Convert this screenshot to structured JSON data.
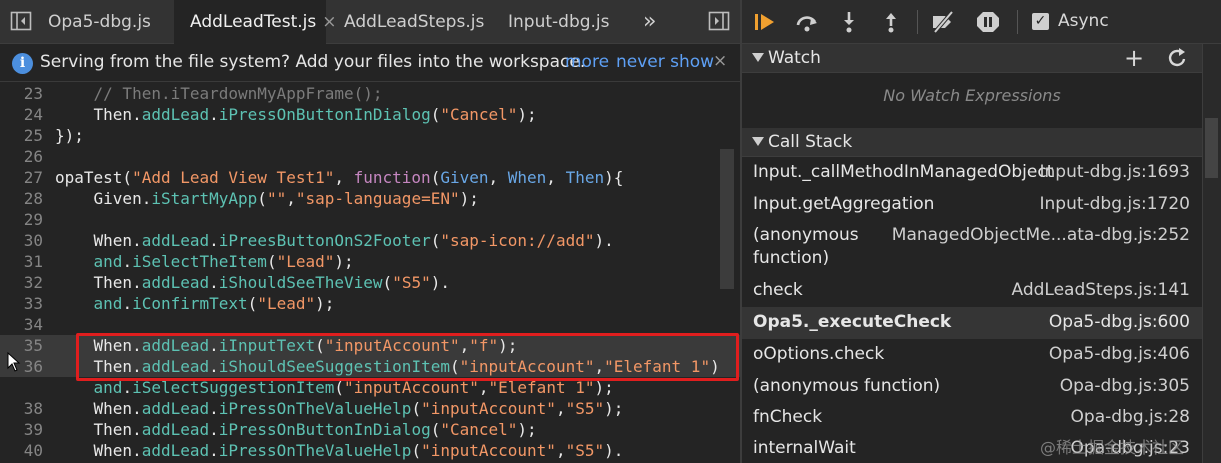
{
  "editor_tabs": [
    {
      "label": "Opa5-dbg.js",
      "active": false,
      "closable": false
    },
    {
      "label": "AddLeadTest.js",
      "active": true,
      "closable": true
    },
    {
      "label": "AddLeadSteps.js",
      "active": false,
      "closable": false
    },
    {
      "label": "Input-dbg.js",
      "active": false,
      "closable": false
    }
  ],
  "overflow_tabs_label": "»",
  "tab_close_glyph": "×",
  "infobar": {
    "icon": "info-icon",
    "message": "Serving from the file system? Add your files into the workspace.",
    "more_label": "more",
    "never_show_label": "never show",
    "close_glyph": "×"
  },
  "code_lines": [
    {
      "num": "23",
      "tokens": [
        [
          "    ",
          "plain"
        ],
        [
          "// Then.iTeardownMyAppFrame();",
          "com"
        ]
      ]
    },
    {
      "num": "24",
      "tokens": [
        [
          "    Then.",
          "plain"
        ],
        [
          "addLead",
          "prop"
        ],
        [
          ".",
          "plain"
        ],
        [
          "iPressOnButtonInDialog",
          "prop"
        ],
        [
          "(",
          "plain"
        ],
        [
          "\"Cancel\"",
          "str"
        ],
        [
          ");",
          "plain"
        ]
      ]
    },
    {
      "num": "25",
      "tokens": [
        [
          "});",
          "plain"
        ]
      ]
    },
    {
      "num": "26",
      "tokens": []
    },
    {
      "num": "27",
      "tokens": [
        [
          "opaTest(",
          "plain"
        ],
        [
          "\"Add Lead View Test1\"",
          "str"
        ],
        [
          ", ",
          "plain"
        ],
        [
          "function",
          "kw"
        ],
        [
          "(",
          "plain"
        ],
        [
          "Given",
          "param"
        ],
        [
          ", ",
          "plain"
        ],
        [
          "When",
          "param"
        ],
        [
          ", ",
          "plain"
        ],
        [
          "Then",
          "param"
        ],
        [
          "){",
          "plain"
        ]
      ]
    },
    {
      "num": "28",
      "tokens": [
        [
          "    Given.",
          "plain"
        ],
        [
          "iStartMyApp",
          "prop"
        ],
        [
          "(",
          "plain"
        ],
        [
          "\"\"",
          "str"
        ],
        [
          ",",
          "plain"
        ],
        [
          "\"sap-language=EN\"",
          "str"
        ],
        [
          ");",
          "plain"
        ]
      ]
    },
    {
      "num": "29",
      "tokens": []
    },
    {
      "num": "30",
      "tokens": [
        [
          "    When.",
          "plain"
        ],
        [
          "addLead",
          "prop"
        ],
        [
          ".",
          "plain"
        ],
        [
          "iPreesButtonOnS2Footer",
          "prop"
        ],
        [
          "(",
          "plain"
        ],
        [
          "\"sap-icon://add\"",
          "str"
        ],
        [
          ").",
          "plain"
        ]
      ]
    },
    {
      "num": "31",
      "tokens": [
        [
          "    ",
          "plain"
        ],
        [
          "and",
          "prop"
        ],
        [
          ".",
          "plain"
        ],
        [
          "iSelectTheItem",
          "prop"
        ],
        [
          "(",
          "plain"
        ],
        [
          "\"Lead\"",
          "str"
        ],
        [
          ");",
          "plain"
        ]
      ]
    },
    {
      "num": "32",
      "tokens": [
        [
          "    Then.",
          "plain"
        ],
        [
          "addLead",
          "prop"
        ],
        [
          ".",
          "plain"
        ],
        [
          "iShouldSeeTheView",
          "prop"
        ],
        [
          "(",
          "plain"
        ],
        [
          "\"S5\"",
          "str"
        ],
        [
          ").",
          "plain"
        ]
      ]
    },
    {
      "num": "33",
      "tokens": [
        [
          "    ",
          "plain"
        ],
        [
          "and",
          "prop"
        ],
        [
          ".",
          "plain"
        ],
        [
          "iConfirmText",
          "prop"
        ],
        [
          "(",
          "plain"
        ],
        [
          "\"Lead\"",
          "str"
        ],
        [
          ");",
          "plain"
        ]
      ]
    },
    {
      "num": "34",
      "tokens": []
    },
    {
      "num": "35",
      "tokens": [
        [
          "    When.",
          "plain"
        ],
        [
          "addLead",
          "prop"
        ],
        [
          ".",
          "plain"
        ],
        [
          "iInputText",
          "prop"
        ],
        [
          "(",
          "plain"
        ],
        [
          "\"inputAccount\"",
          "str"
        ],
        [
          ",",
          "plain"
        ],
        [
          "\"f\"",
          "str"
        ],
        [
          ");",
          "plain"
        ]
      ],
      "highlight": true
    },
    {
      "num": "36",
      "tokens": [
        [
          "    Then.",
          "plain"
        ],
        [
          "addLead",
          "prop"
        ],
        [
          ".",
          "plain"
        ],
        [
          "iShouldSeeSuggestionItem",
          "prop"
        ],
        [
          "(",
          "plain"
        ],
        [
          "\"inputAccount\"",
          "str"
        ],
        [
          ",",
          "plain"
        ],
        [
          "\"Elefant 1\"",
          "str"
        ],
        [
          ")",
          "plain"
        ]
      ],
      "highlight": true
    },
    {
      "num": "",
      "tokens": [
        [
          "    ",
          "plain"
        ],
        [
          "and",
          "prop"
        ],
        [
          ".",
          "plain"
        ],
        [
          "iSelectSuggestionItem",
          "prop"
        ],
        [
          "(",
          "plain"
        ],
        [
          "\"inputAccount\"",
          "str"
        ],
        [
          ",",
          "plain"
        ],
        [
          "\"Elefant 1\"",
          "str"
        ],
        [
          ");",
          "plain"
        ]
      ]
    },
    {
      "num": "38",
      "tokens": [
        [
          "    When.",
          "plain"
        ],
        [
          "addLead",
          "prop"
        ],
        [
          ".",
          "plain"
        ],
        [
          "iPressOnTheValueHelp",
          "prop"
        ],
        [
          "(",
          "plain"
        ],
        [
          "\"inputAccount\"",
          "str"
        ],
        [
          ",",
          "plain"
        ],
        [
          "\"S5\"",
          "str"
        ],
        [
          ");",
          "plain"
        ]
      ]
    },
    {
      "num": "39",
      "tokens": [
        [
          "    Then.",
          "plain"
        ],
        [
          "addLead",
          "prop"
        ],
        [
          ".",
          "plain"
        ],
        [
          "iPressOnButtonInDialog",
          "prop"
        ],
        [
          "(",
          "plain"
        ],
        [
          "\"Cancel\"",
          "str"
        ],
        [
          ");",
          "plain"
        ]
      ]
    },
    {
      "num": "40",
      "tokens": [
        [
          "    When.",
          "plain"
        ],
        [
          "addLead",
          "prop"
        ],
        [
          ".",
          "plain"
        ],
        [
          "iPressOnTheValueHelp",
          "prop"
        ],
        [
          "(",
          "plain"
        ],
        [
          "\"inputAccount\"",
          "str"
        ],
        [
          ",",
          "plain"
        ],
        [
          "\"S5\"",
          "str"
        ],
        [
          ").",
          "plain"
        ]
      ]
    }
  ],
  "debugger": {
    "async_label": "Async",
    "async_checked": true,
    "async_check_glyph": "✓",
    "watch_title": "Watch",
    "watch_add_glyph": "+",
    "no_watch": "No Watch Expressions",
    "callstack_title": "Call Stack",
    "frames": [
      {
        "fn": "Input._callMethodInManagedObject",
        "loc": "Input-dbg.js:1693",
        "selected": false
      },
      {
        "fn": "Input.getAggregation",
        "loc": "Input-dbg.js:1720",
        "selected": false
      },
      {
        "fn": "(anonymous function)",
        "loc": "ManagedObjectMe...ata-dbg.js:252",
        "selected": false
      },
      {
        "fn": "check",
        "loc": "AddLeadSteps.js:141",
        "selected": false
      },
      {
        "fn": "Opa5._executeCheck",
        "loc": "Opa5-dbg.js:600",
        "selected": true
      },
      {
        "fn": "oOptions.check",
        "loc": "Opa5-dbg.js:406",
        "selected": false
      },
      {
        "fn": "(anonymous function)",
        "loc": "Opa-dbg.js:305",
        "selected": false
      },
      {
        "fn": "fnCheck",
        "loc": "Opa-dbg.js:28",
        "selected": false
      },
      {
        "fn": "internalWait",
        "loc": "Opa-dbg.js:23",
        "selected": false
      }
    ]
  },
  "watermark": "@稀土掘金技术社区",
  "colors": {
    "accent_orange": "#f0a030",
    "link_blue": "#5ea0f5",
    "highlight_box": "#e01e1e"
  }
}
